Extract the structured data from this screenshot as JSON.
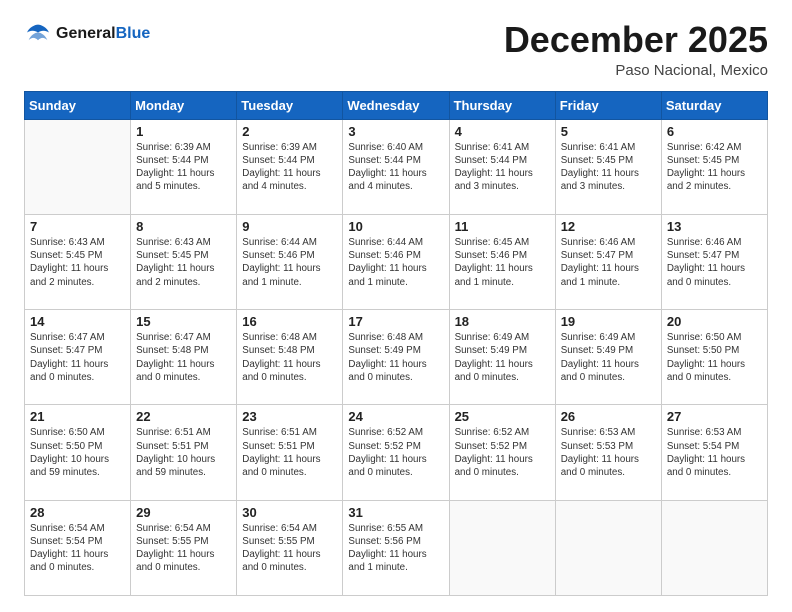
{
  "header": {
    "logo_line1": "General",
    "logo_line2": "Blue",
    "month": "December 2025",
    "location": "Paso Nacional, Mexico"
  },
  "weekdays": [
    "Sunday",
    "Monday",
    "Tuesday",
    "Wednesday",
    "Thursday",
    "Friday",
    "Saturday"
  ],
  "weeks": [
    [
      {
        "day": "",
        "info": ""
      },
      {
        "day": "1",
        "info": "Sunrise: 6:39 AM\nSunset: 5:44 PM\nDaylight: 11 hours\nand 5 minutes."
      },
      {
        "day": "2",
        "info": "Sunrise: 6:39 AM\nSunset: 5:44 PM\nDaylight: 11 hours\nand 4 minutes."
      },
      {
        "day": "3",
        "info": "Sunrise: 6:40 AM\nSunset: 5:44 PM\nDaylight: 11 hours\nand 4 minutes."
      },
      {
        "day": "4",
        "info": "Sunrise: 6:41 AM\nSunset: 5:44 PM\nDaylight: 11 hours\nand 3 minutes."
      },
      {
        "day": "5",
        "info": "Sunrise: 6:41 AM\nSunset: 5:45 PM\nDaylight: 11 hours\nand 3 minutes."
      },
      {
        "day": "6",
        "info": "Sunrise: 6:42 AM\nSunset: 5:45 PM\nDaylight: 11 hours\nand 2 minutes."
      }
    ],
    [
      {
        "day": "7",
        "info": "Sunrise: 6:43 AM\nSunset: 5:45 PM\nDaylight: 11 hours\nand 2 minutes."
      },
      {
        "day": "8",
        "info": "Sunrise: 6:43 AM\nSunset: 5:45 PM\nDaylight: 11 hours\nand 2 minutes."
      },
      {
        "day": "9",
        "info": "Sunrise: 6:44 AM\nSunset: 5:46 PM\nDaylight: 11 hours\nand 1 minute."
      },
      {
        "day": "10",
        "info": "Sunrise: 6:44 AM\nSunset: 5:46 PM\nDaylight: 11 hours\nand 1 minute."
      },
      {
        "day": "11",
        "info": "Sunrise: 6:45 AM\nSunset: 5:46 PM\nDaylight: 11 hours\nand 1 minute."
      },
      {
        "day": "12",
        "info": "Sunrise: 6:46 AM\nSunset: 5:47 PM\nDaylight: 11 hours\nand 1 minute."
      },
      {
        "day": "13",
        "info": "Sunrise: 6:46 AM\nSunset: 5:47 PM\nDaylight: 11 hours\nand 0 minutes."
      }
    ],
    [
      {
        "day": "14",
        "info": "Sunrise: 6:47 AM\nSunset: 5:47 PM\nDaylight: 11 hours\nand 0 minutes."
      },
      {
        "day": "15",
        "info": "Sunrise: 6:47 AM\nSunset: 5:48 PM\nDaylight: 11 hours\nand 0 minutes."
      },
      {
        "day": "16",
        "info": "Sunrise: 6:48 AM\nSunset: 5:48 PM\nDaylight: 11 hours\nand 0 minutes."
      },
      {
        "day": "17",
        "info": "Sunrise: 6:48 AM\nSunset: 5:49 PM\nDaylight: 11 hours\nand 0 minutes."
      },
      {
        "day": "18",
        "info": "Sunrise: 6:49 AM\nSunset: 5:49 PM\nDaylight: 11 hours\nand 0 minutes."
      },
      {
        "day": "19",
        "info": "Sunrise: 6:49 AM\nSunset: 5:49 PM\nDaylight: 11 hours\nand 0 minutes."
      },
      {
        "day": "20",
        "info": "Sunrise: 6:50 AM\nSunset: 5:50 PM\nDaylight: 11 hours\nand 0 minutes."
      }
    ],
    [
      {
        "day": "21",
        "info": "Sunrise: 6:50 AM\nSunset: 5:50 PM\nDaylight: 10 hours\nand 59 minutes."
      },
      {
        "day": "22",
        "info": "Sunrise: 6:51 AM\nSunset: 5:51 PM\nDaylight: 10 hours\nand 59 minutes."
      },
      {
        "day": "23",
        "info": "Sunrise: 6:51 AM\nSunset: 5:51 PM\nDaylight: 11 hours\nand 0 minutes."
      },
      {
        "day": "24",
        "info": "Sunrise: 6:52 AM\nSunset: 5:52 PM\nDaylight: 11 hours\nand 0 minutes."
      },
      {
        "day": "25",
        "info": "Sunrise: 6:52 AM\nSunset: 5:52 PM\nDaylight: 11 hours\nand 0 minutes."
      },
      {
        "day": "26",
        "info": "Sunrise: 6:53 AM\nSunset: 5:53 PM\nDaylight: 11 hours\nand 0 minutes."
      },
      {
        "day": "27",
        "info": "Sunrise: 6:53 AM\nSunset: 5:54 PM\nDaylight: 11 hours\nand 0 minutes."
      }
    ],
    [
      {
        "day": "28",
        "info": "Sunrise: 6:54 AM\nSunset: 5:54 PM\nDaylight: 11 hours\nand 0 minutes."
      },
      {
        "day": "29",
        "info": "Sunrise: 6:54 AM\nSunset: 5:55 PM\nDaylight: 11 hours\nand 0 minutes."
      },
      {
        "day": "30",
        "info": "Sunrise: 6:54 AM\nSunset: 5:55 PM\nDaylight: 11 hours\nand 0 minutes."
      },
      {
        "day": "31",
        "info": "Sunrise: 6:55 AM\nSunset: 5:56 PM\nDaylight: 11 hours\nand 1 minute."
      },
      {
        "day": "",
        "info": ""
      },
      {
        "day": "",
        "info": ""
      },
      {
        "day": "",
        "info": ""
      }
    ]
  ]
}
